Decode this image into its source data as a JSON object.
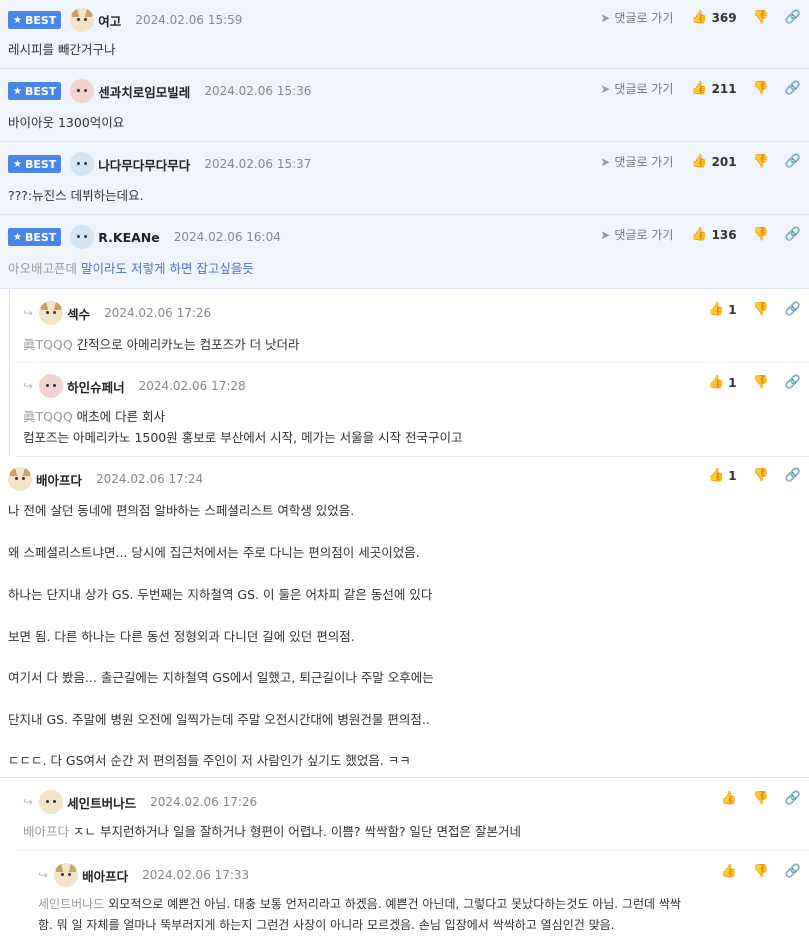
{
  "comments": [
    {
      "badge": "BEST",
      "nick": "여고",
      "date": "2024.02.06 15:59",
      "reply_label": "댓글로 가기",
      "likes": "369",
      "text": "레시피를 빼간거구나"
    },
    {
      "badge": "BEST",
      "nick": "센과치로임모빌레",
      "date": "2024.02.06 15:36",
      "reply_label": "댓글로 가기",
      "likes": "211",
      "text": "바이아웃 1300억이요"
    },
    {
      "badge": "BEST",
      "nick": "나다무다무다무다",
      "date": "2024.02.06 15:37",
      "reply_label": "댓글로 가기",
      "likes": "201",
      "text": "???:뉴진스 데뷔하는데요."
    },
    {
      "badge": "BEST",
      "nick": "R.KEANe",
      "date": "2024.02.06 16:04",
      "reply_label": "댓글로 가기",
      "likes": "136",
      "target": "아오배고픈데",
      "text": "말이라도 저렇게 하면 잡고싶을듯"
    },
    {
      "nick": "섹수",
      "date": "2024.02.06 17:26",
      "likes": "1",
      "target": "眞TQQQ",
      "text": "간적으로 아메리카노는 컴포즈가 더 낫더라"
    },
    {
      "nick": "하인슈페너",
      "date": "2024.02.06 17:28",
      "likes": "1",
      "target": "眞TQQQ",
      "text": "애초에 다른 회사",
      "text2": "컴포즈는 아메리카노 1500원 홍보로 부산에서 시작, 메가는 서울을 시작 전국구이고"
    },
    {
      "nick": "배아프다",
      "date": "2024.02.06 17:24",
      "likes": "1",
      "lines": [
        "나 전에 살던 동네에 편의점 알바하는 스페셜리스트 여학생 있었음.",
        "왜 스페셜리스트냐면... 당시에 집근처에서는 주로 다니는 편의점이 세곳이었음.",
        "하나는 단지내 상가 GS. 두번째는 지하철역 GS. 이 둘은 어차피 같은 동선에 있다",
        "보면 됨. 다른 하나는 다른 동선 정형외과 다니던 길에 있던 편의점.",
        "여기서 다 봤음... 출근길에는 지하철역 GS에서 일했고, 퇴근길이나 주말 오후에는",
        "단지내 GS. 주말에 병원 오전에 일찍가는데 주말 오전시간대에 병원건물 편의점..",
        "ㄷㄷㄷ. 다 GS여서 순간 저 편의점들 주인이 저 사람인가 싶기도 했었음. ㅋㅋ"
      ]
    },
    {
      "nick": "세인트버나드",
      "date": "2024.02.06 17:26",
      "target": "배아프다",
      "text": "ㅈㄴ 부지런하거나 일을 잘하거나 형편이 어렵나. 이쁨? 싹싹함? 일단 면접은 잘본거네"
    },
    {
      "nick": "배아프다",
      "date": "2024.02.06 17:33",
      "target": "세인트버나드",
      "text": "외모적으로 예쁜건 아님. 대충 보통 언저리라고 하겠음. 예쁜건 아닌데, 그렇다고 못났다하는것도 아님. 그런데 싹싹",
      "text2": "함. 뭐 일 자체를 얼마나 뚝부러지게 하는지 그런건 사장이 아니라 모르겠음. 손님 입장에서 싹싹하고 열심인건 맞음."
    }
  ]
}
